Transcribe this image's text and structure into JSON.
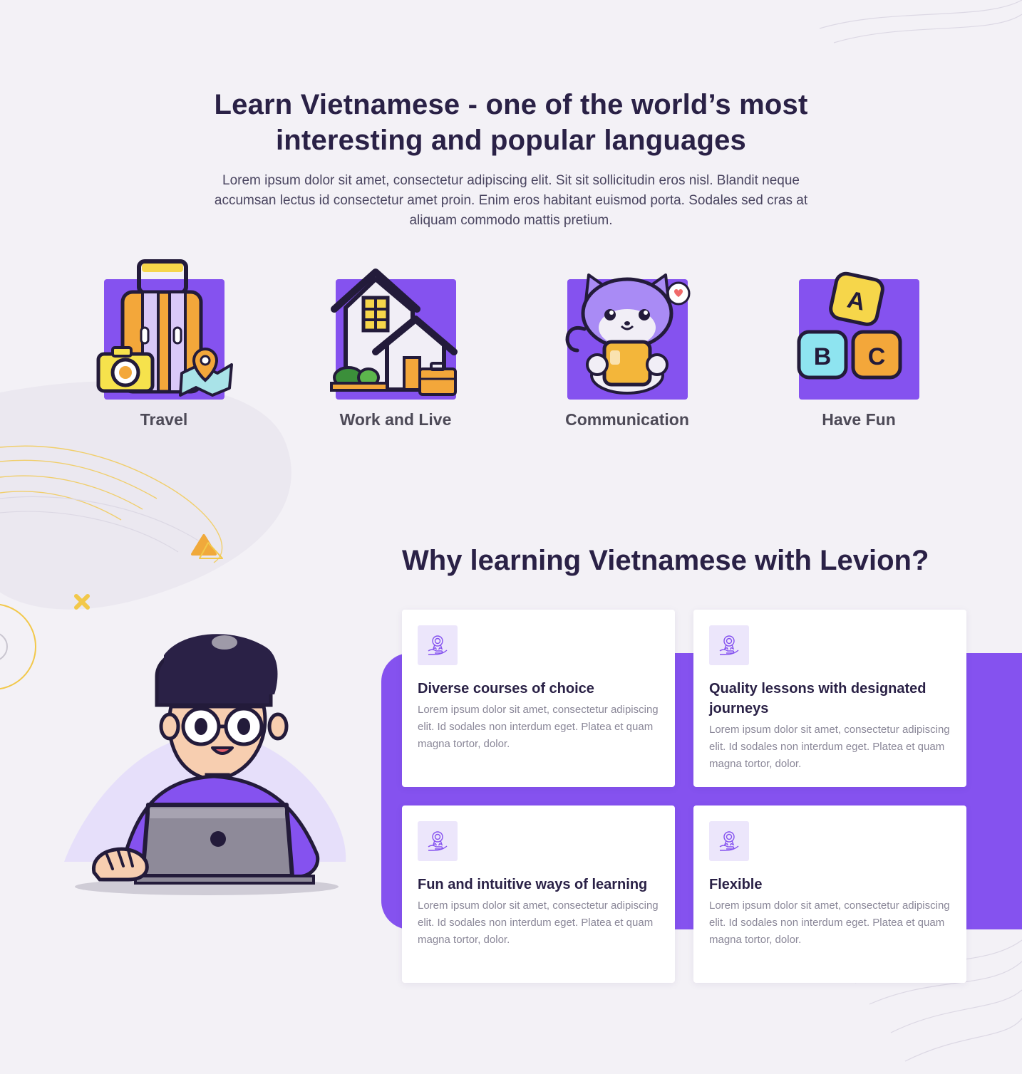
{
  "intro": {
    "title": "Learn Vietnamese - one of the world’s most interesting and popular languages",
    "description": "Lorem ipsum dolor sit amet, consectetur adipiscing elit. Sit sit sollicitudin eros nisl. Blandit neque accumsan lectus id consectetur amet proin. Enim eros habitant euismod porta. Sodales sed cras at aliquam commodo mattis pretium."
  },
  "features": [
    {
      "label": "Travel",
      "icon": "suitcase-camera-map-icon"
    },
    {
      "label": "Work and Live",
      "icon": "house-briefcase-icon"
    },
    {
      "label": "Communication",
      "icon": "cat-phone-icon"
    },
    {
      "label": "Have Fun",
      "icon": "abc-blocks-icon"
    }
  ],
  "why": {
    "title": "Why learning Vietnamese with Levion?",
    "cards": [
      {
        "title": "Diverse courses of choice",
        "text": "Lorem ipsum dolor sit amet, consectetur adipiscing elit. Id sodales non interdum eget. Platea et quam magna tortor, dolor.",
        "icon": "award-hand-icon"
      },
      {
        "title": "Quality lessons with designated journeys",
        "text": "Lorem ipsum dolor sit amet, consectetur adipiscing elit. Id sodales non interdum eget. Platea et quam magna tortor, dolor.",
        "icon": "award-hand-icon"
      },
      {
        "title": "Fun and intuitive ways of learning",
        "text": "Lorem ipsum dolor sit amet, consectetur adipiscing elit. Id sodales non interdum eget. Platea et quam magna tortor, dolor.",
        "icon": "award-hand-icon"
      },
      {
        "title": "Flexible",
        "text": "Lorem ipsum dolor sit amet, consectetur adipiscing elit. Id sodales non interdum eget. Platea et quam magna tortor, dolor.",
        "icon": "award-hand-icon"
      }
    ]
  },
  "illustration": {
    "name": "student-with-laptop-illustration"
  },
  "colors": {
    "brand_purple": "#8552ef",
    "heading": "#2a2146",
    "accent_yellow": "#f4c64a",
    "accent_orange": "#f0a93b"
  }
}
